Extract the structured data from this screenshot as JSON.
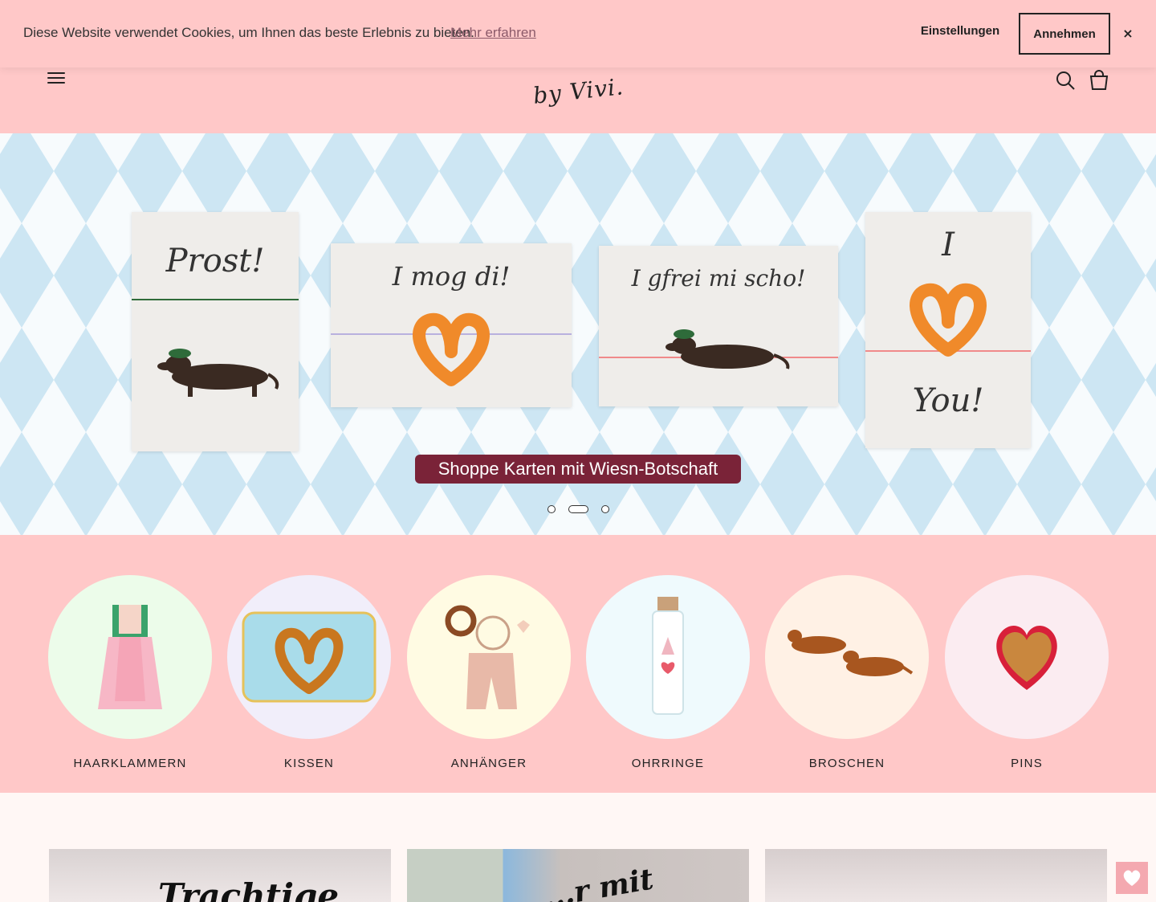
{
  "cookie": {
    "message": "Diese Website verwendet Cookies, um Ihnen das beste Erlebnis zu bieten.",
    "link": "Mehr erfahren",
    "settings": "Einstellungen",
    "accept": "Annehmen",
    "close": "×"
  },
  "header": {
    "logo": "by Vivi.",
    "icons": [
      "menu-icon",
      "search-icon",
      "cart-icon"
    ]
  },
  "hero": {
    "cards": [
      {
        "text": "Prost!"
      },
      {
        "text": "I mog di!"
      },
      {
        "text": "I gfrei mi scho!"
      },
      {
        "text_top": "I",
        "text_bottom": "You!"
      }
    ],
    "banner": "Shoppe Karten mit Wiesn-Botschaft",
    "slides": 3,
    "active_slide": 2
  },
  "categories": [
    {
      "label": "HAARKLAMMERN",
      "bg": "#ecfcea",
      "icon": "dirndl-icon"
    },
    {
      "label": "KISSEN",
      "bg": "#f1eefa",
      "icon": "pretzel-pillow-icon"
    },
    {
      "label": "ANHÄNGER",
      "bg": "#fffbe3",
      "icon": "lederhosen-keychain-icon"
    },
    {
      "label": "OHRRINGE",
      "bg": "#effafd",
      "icon": "earring-bottle-icon"
    },
    {
      "label": "BROSCHEN",
      "bg": "#fff1e5",
      "icon": "dachshund-brooch-icon"
    },
    {
      "label": "PINS",
      "bg": "#fbecf1",
      "icon": "gingerbread-heart-icon"
    }
  ],
  "promos": [
    {
      "text": "Trachtige"
    },
    {
      "text": "...r mit"
    },
    {
      "text": ""
    }
  ],
  "colors": {
    "header_bg": "#ffc8c8",
    "hero_diamond": "#cde6f3",
    "banner_bg": "#7a2338",
    "wishlist_bg": "#f4a9b0"
  }
}
